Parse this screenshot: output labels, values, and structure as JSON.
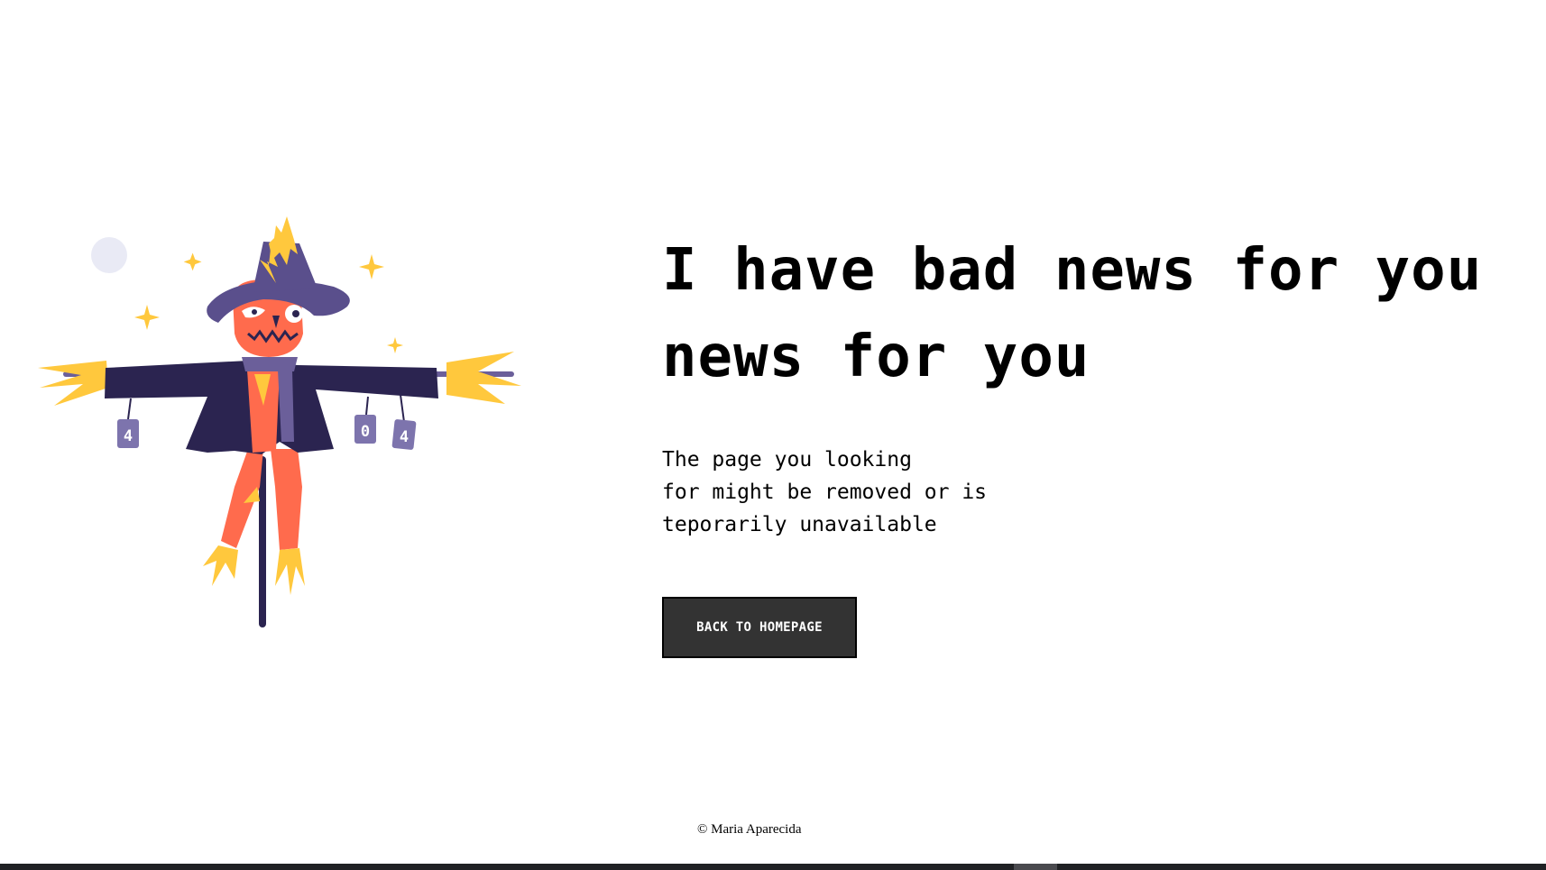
{
  "headline": {
    "line1": "I have bad news for you",
    "line2": "news for you"
  },
  "message": {
    "line1": "The page you looking",
    "line2": "for might be removed or is",
    "line3": "teporarily unavailable"
  },
  "cta": {
    "label": "BACK TO HOMEPAGE"
  },
  "illustration": {
    "can_labels": [
      "4",
      "0",
      "4"
    ]
  },
  "footer": {
    "copyright": "© Maria Aparecida"
  },
  "colors": {
    "coat": "#2b2450",
    "hat": "#5a4f8c",
    "scarf": "#6b5f9a",
    "pants": "#ff6b4d",
    "straw": "#ffc83d",
    "can": "#7d74ad",
    "moon": "#e9eaf5",
    "button": "#333333"
  }
}
